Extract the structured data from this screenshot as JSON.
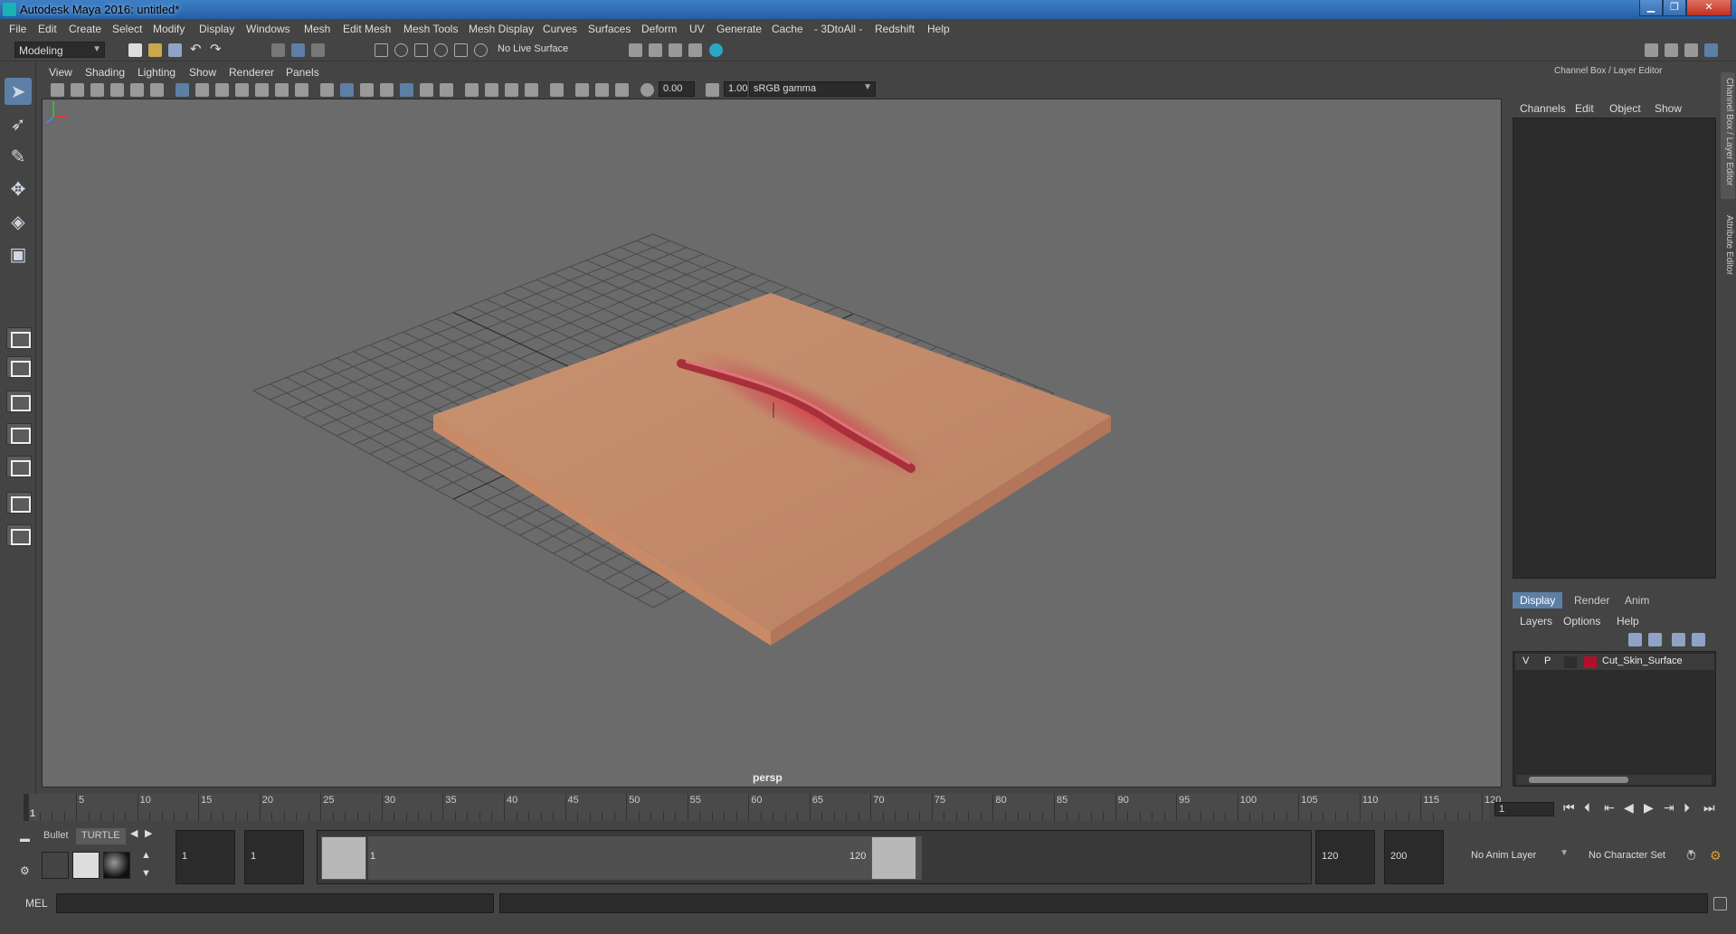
{
  "window": {
    "title": "Autodesk Maya 2016: untitled*"
  },
  "menubar": [
    "File",
    "Edit",
    "Create",
    "Select",
    "Modify",
    "Display",
    "Windows",
    "Mesh",
    "Edit Mesh",
    "Mesh Tools",
    "Mesh Display",
    "Curves",
    "Surfaces",
    "Deform",
    "UV",
    "Generate",
    "Cache",
    "- 3DtoAll -",
    "Redshift",
    "Help"
  ],
  "statusline": {
    "mode": "Modeling",
    "live_surface": "No Live Surface"
  },
  "panel": {
    "menus": [
      "View",
      "Shading",
      "Lighting",
      "Show",
      "Renderer",
      "Panels"
    ],
    "exposure": "0.00",
    "gamma": "1.00",
    "colorspace": "sRGB gamma",
    "camera": "persp"
  },
  "channel_box": {
    "title": "Channel Box / Layer Editor",
    "menus": [
      "Channels",
      "Edit",
      "Object",
      "Show"
    ]
  },
  "side_tabs": [
    "Channel Box / Layer Editor",
    "Attribute Editor"
  ],
  "layer_editor": {
    "tabs": [
      "Display",
      "Render",
      "Anim"
    ],
    "active_tab": "Display",
    "menus": [
      "Layers",
      "Options",
      "Help"
    ],
    "layers": [
      {
        "v": "V",
        "p": "P",
        "name": "Cut_Skin_Surface",
        "color": "#b0102a"
      }
    ]
  },
  "timeline": {
    "ticks": [
      "1",
      "5",
      "10",
      "15",
      "20",
      "25",
      "30",
      "35",
      "40",
      "45",
      "50",
      "55",
      "60",
      "65",
      "70",
      "75",
      "80",
      "85",
      "90",
      "95",
      "100",
      "105",
      "110",
      "115",
      "120"
    ],
    "current_frame": "1"
  },
  "range": {
    "shelf_tabs": [
      "Bullet",
      "TURTLE"
    ],
    "start_time": "1",
    "playback_start": "1",
    "range_start_label": "1",
    "range_end_label": "120",
    "playback_end": "120",
    "end_time": "200",
    "anim_layer": "No Anim Layer",
    "character_set": "No Character Set"
  },
  "cmdline": {
    "label": "MEL"
  }
}
